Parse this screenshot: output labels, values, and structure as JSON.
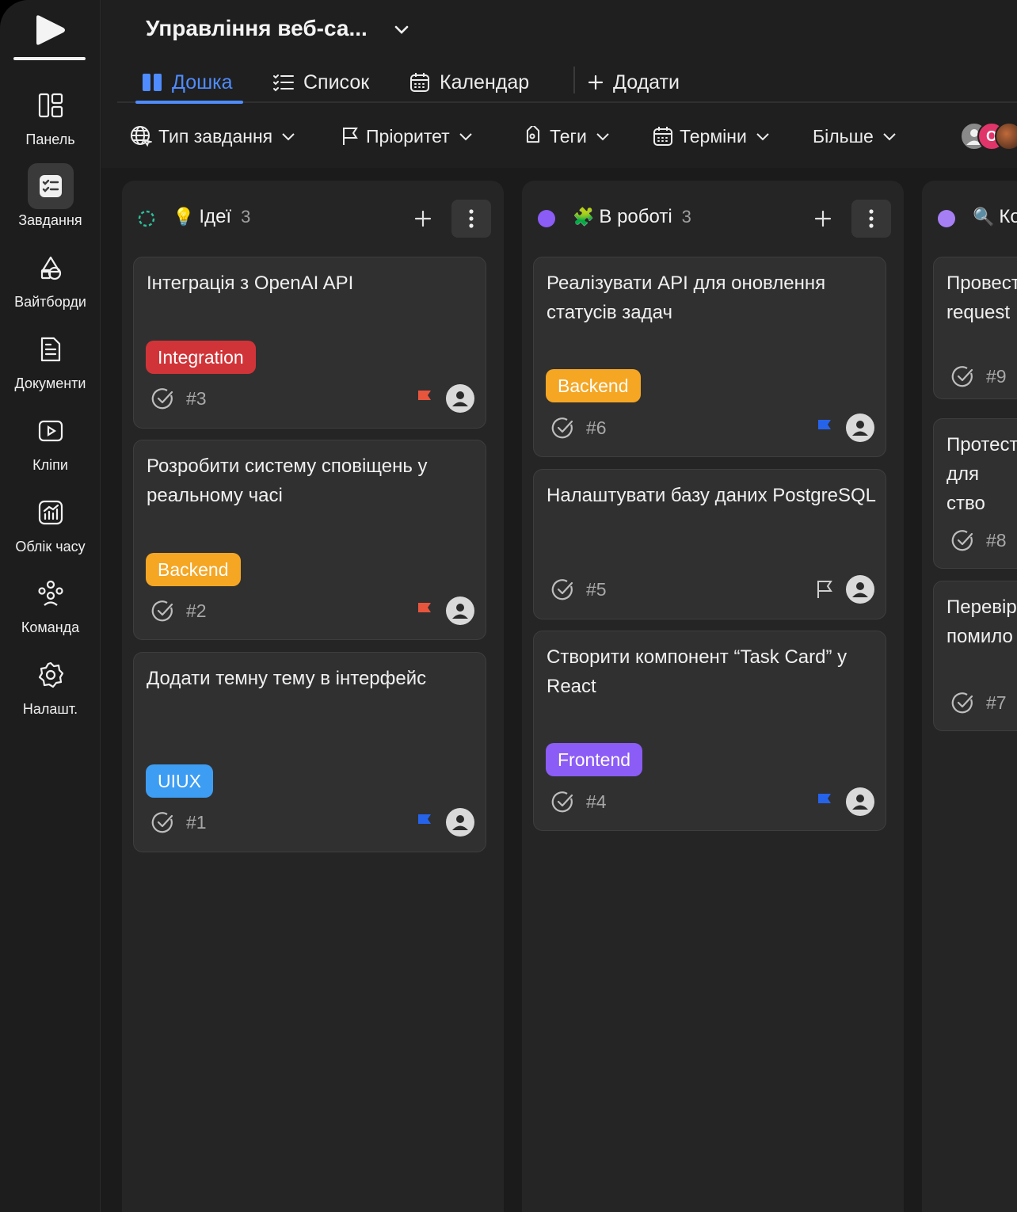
{
  "sidebar": {
    "items": [
      {
        "id": "panel",
        "label": "Панель",
        "icon": "dashboard-icon"
      },
      {
        "id": "tasks",
        "label": "Завдання",
        "icon": "tasks-icon",
        "active": true
      },
      {
        "id": "whiteboards",
        "label": "Вайтборди",
        "icon": "whiteboard-icon"
      },
      {
        "id": "docs",
        "label": "Документи",
        "icon": "document-icon"
      },
      {
        "id": "clips",
        "label": "Кліпи",
        "icon": "video-icon"
      },
      {
        "id": "time",
        "label": "Облік часу",
        "icon": "chart-icon"
      },
      {
        "id": "team",
        "label": "Команда",
        "icon": "team-icon"
      },
      {
        "id": "settings",
        "label": "Налашт.",
        "icon": "gear-icon"
      }
    ]
  },
  "header": {
    "project_title": "Управління веб-са...",
    "tabs": [
      {
        "label": "Дошка",
        "icon": "board-icon",
        "active": true
      },
      {
        "label": "Список",
        "icon": "list-icon"
      },
      {
        "label": "Календар",
        "icon": "calendar-icon"
      },
      {
        "label": "Додати",
        "icon": "plus-icon"
      }
    ],
    "filters": [
      {
        "label": "Тип завдання",
        "icon": "globe-icon"
      },
      {
        "label": "Пріоритет",
        "icon": "flag-icon"
      },
      {
        "label": "Теги",
        "icon": "tag-icon"
      },
      {
        "label": "Терміни",
        "icon": "calendar-icon"
      },
      {
        "label": "Більше",
        "icon": ""
      }
    ],
    "avatar_initial": "O"
  },
  "colors": {
    "accent": "#4f8cff",
    "integration": "#d13438",
    "backend": "#f5a623",
    "uiux": "#3d9df3",
    "frontend": "#8b5cf6",
    "flag_red": "#e8553d",
    "flag_blue": "#2563eb",
    "status_purple": "#8b5cf6"
  },
  "columns": [
    {
      "name": "Ідеї",
      "emoji": "💡",
      "count": "3",
      "cards": [
        {
          "title": "Інтеграція з OpenAI API",
          "tag": "Integration",
          "id": "#3",
          "flag": "red"
        },
        {
          "title": "Розробити систему сповіщень у реальному часі",
          "tag": "Backend",
          "id": "#2",
          "flag": "red"
        },
        {
          "title": "Додати темну тему в інтерфейс",
          "tag": "UIUX",
          "id": "#1",
          "flag": "blue"
        }
      ]
    },
    {
      "name": "В роботі",
      "emoji": "🧩",
      "count": "3",
      "cards": [
        {
          "title": "Реалізувати API для оновлення статусів задач",
          "tag": "Backend",
          "id": "#6",
          "flag": "blue"
        },
        {
          "title": "Налаштувати базу даних PostgreSQL",
          "tag": "",
          "id": "#5",
          "flag": "outline"
        },
        {
          "title": "Створити компонент “Task Card” у React",
          "tag": "Frontend",
          "id": "#4",
          "flag": "blue"
        }
      ]
    },
    {
      "name": "Ко",
      "emoji": "🔍",
      "count": "",
      "cards": [
        {
          "title": "Провест request",
          "id": "#9"
        },
        {
          "title": "Протест для ство",
          "id": "#8"
        },
        {
          "title": "Перевір помило",
          "id": "#7"
        }
      ]
    }
  ]
}
